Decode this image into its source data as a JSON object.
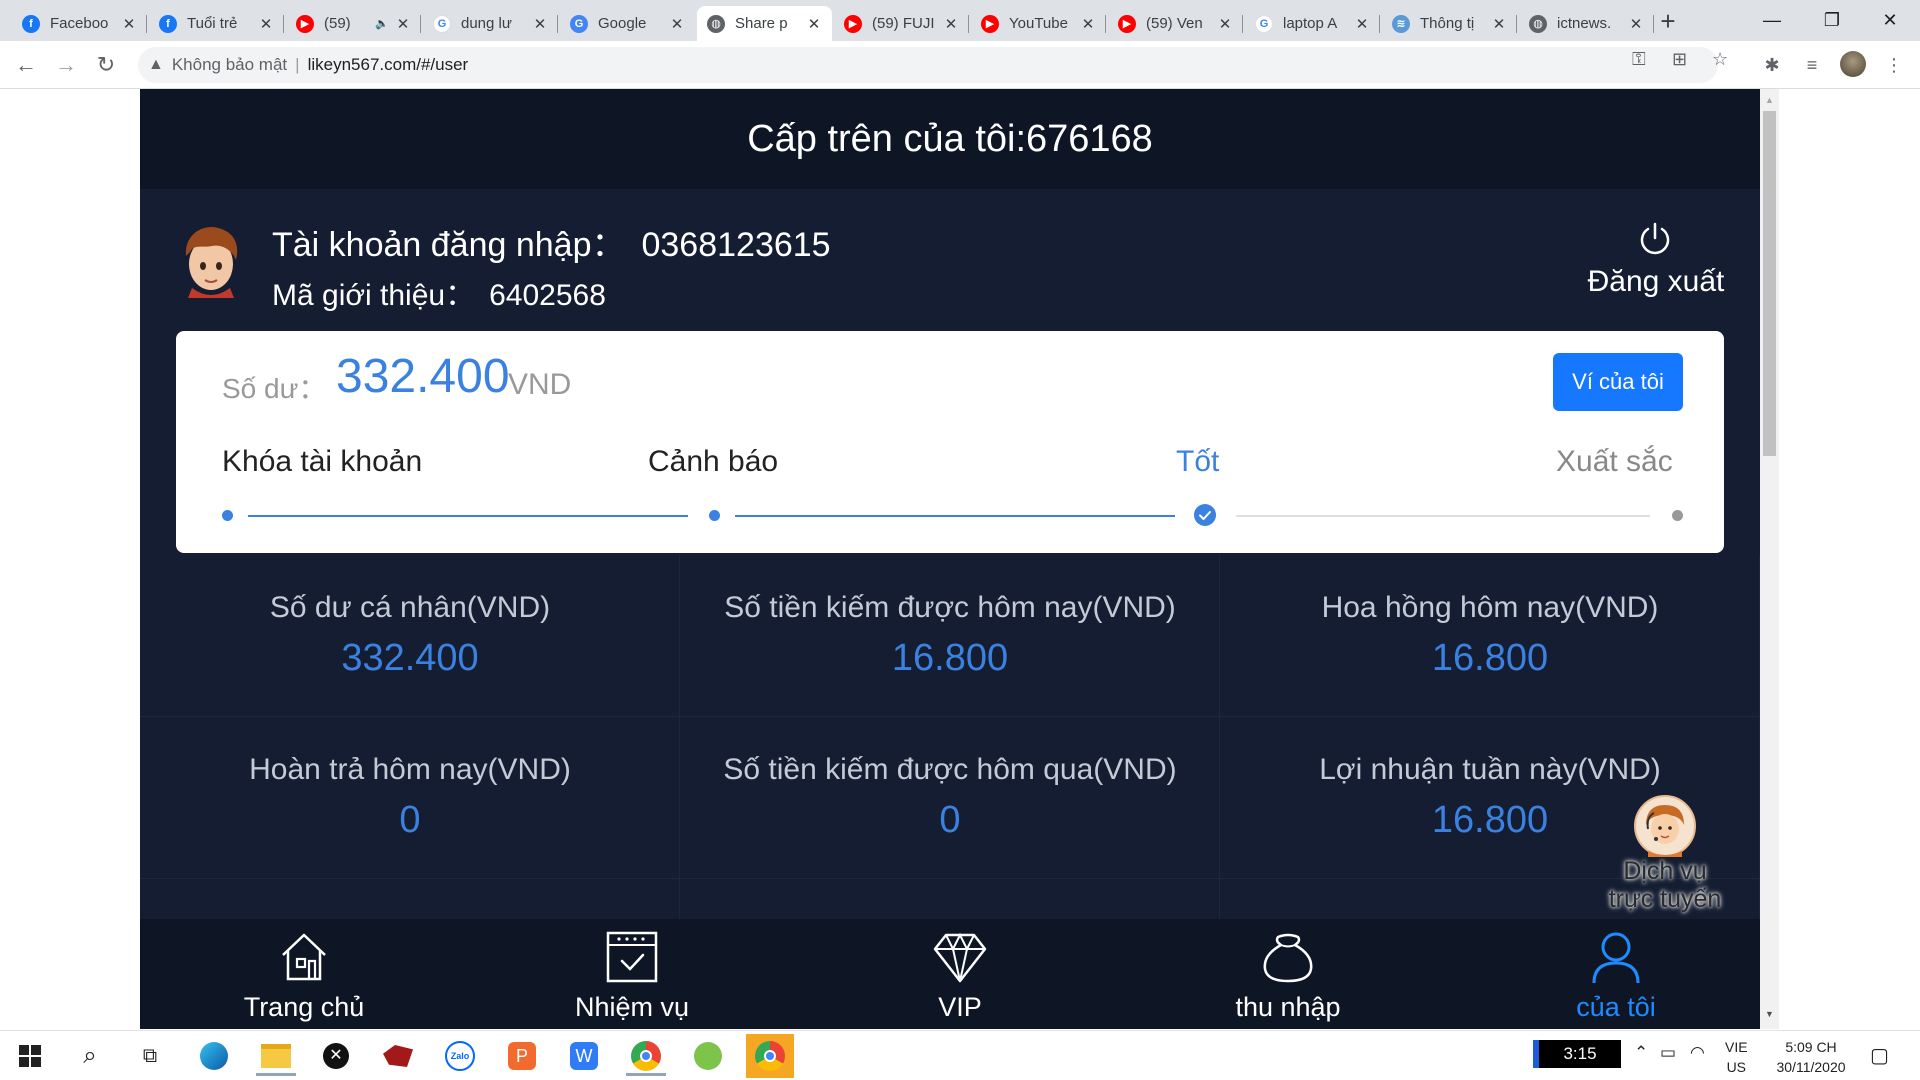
{
  "browser": {
    "tabs": [
      {
        "title": "Faceboo",
        "icon": "facebook-icon",
        "color": "#1877f2",
        "glyph": "f"
      },
      {
        "title": "Tuổi trẻ",
        "icon": "facebook-icon",
        "color": "#1877f2",
        "glyph": "f"
      },
      {
        "title": "(59)",
        "icon": "youtube-icon",
        "color": "#ff0000",
        "glyph": "▶",
        "audio": "🔈"
      },
      {
        "title": "dung lư",
        "icon": "google-icon",
        "color": "#ffffff",
        "glyph": "G"
      },
      {
        "title": "Google",
        "icon": "translate-icon",
        "color": "#4285f4",
        "glyph": "G"
      },
      {
        "title": "Share p",
        "icon": "globe-icon",
        "color": "#5f6368",
        "glyph": "◍"
      },
      {
        "title": "(59) FUJI",
        "icon": "youtube-icon",
        "color": "#ff0000",
        "glyph": "▶"
      },
      {
        "title": "YouTube",
        "icon": "youtube-icon",
        "color": "#ff0000",
        "glyph": "▶"
      },
      {
        "title": "(59) Ven",
        "icon": "youtube-icon",
        "color": "#ff0000",
        "glyph": "▶"
      },
      {
        "title": "laptop A",
        "icon": "google-icon",
        "color": "#ffffff",
        "glyph": "G"
      },
      {
        "title": "Thông tị",
        "icon": "site-icon",
        "color": "#5b9bd5",
        "glyph": "≋"
      },
      {
        "title": "ictnews.",
        "icon": "globe-icon",
        "color": "#5f6368",
        "glyph": "◍"
      }
    ],
    "active_tab_index": 5,
    "address": {
      "security_label": "Không bảo mật",
      "url": "likeyn567.com/#/user"
    }
  },
  "page": {
    "header_title": "Cấp trên của tôi:676168",
    "account_label": "Tài khoản đăng nhập：",
    "account_value": "0368123615",
    "referral_label": "Mã giới thiệu：",
    "referral_value": "6402568",
    "logout_label": "Đăng xuất",
    "balance": {
      "label": "Số dư：",
      "value": "332.400",
      "unit": "VND",
      "wallet_button": "Ví của tôi"
    },
    "levels": [
      {
        "label": "Khóa tài khoản",
        "state": "done"
      },
      {
        "label": "Cảnh báo",
        "state": "done"
      },
      {
        "label": "Tốt",
        "state": "current"
      },
      {
        "label": "Xuất sắc",
        "state": "future"
      }
    ],
    "stats": [
      {
        "label": "Số dư cá nhân(VND)",
        "value": "332.400"
      },
      {
        "label": "Số tiền kiếm được hôm nay(VND)",
        "value": "16.800"
      },
      {
        "label": "Hoa hồng hôm nay(VND)",
        "value": "16.800"
      },
      {
        "label": "Hoàn trả hôm nay(VND)",
        "value": "0"
      },
      {
        "label": "Số tiền kiếm được hôm qua(VND)",
        "value": "0"
      },
      {
        "label": "Lợi nhuận tuần này(VND)",
        "value": "16.800"
      }
    ],
    "support_label_line1": "Dịch vụ",
    "support_label_line2": "trực tuyến",
    "nav": [
      {
        "label": "Trang chủ",
        "icon": "home-icon"
      },
      {
        "label": "Nhiệm vụ",
        "icon": "task-calendar-icon"
      },
      {
        "label": "VIP",
        "icon": "diamond-icon"
      },
      {
        "label": "thu nhập",
        "icon": "money-bag-icon"
      },
      {
        "label": "của tôi",
        "icon": "user-icon",
        "active": true
      }
    ]
  },
  "taskbar": {
    "clock_widget": "3:15",
    "lang_line1": "VIE",
    "lang_line2": "US",
    "time": "5:09 CH",
    "date": "30/11/2020"
  },
  "colors": {
    "accent": "#3b82e0",
    "page_bg": "#141d31",
    "header_bg": "#0e1626",
    "button_blue": "#1677ff"
  }
}
